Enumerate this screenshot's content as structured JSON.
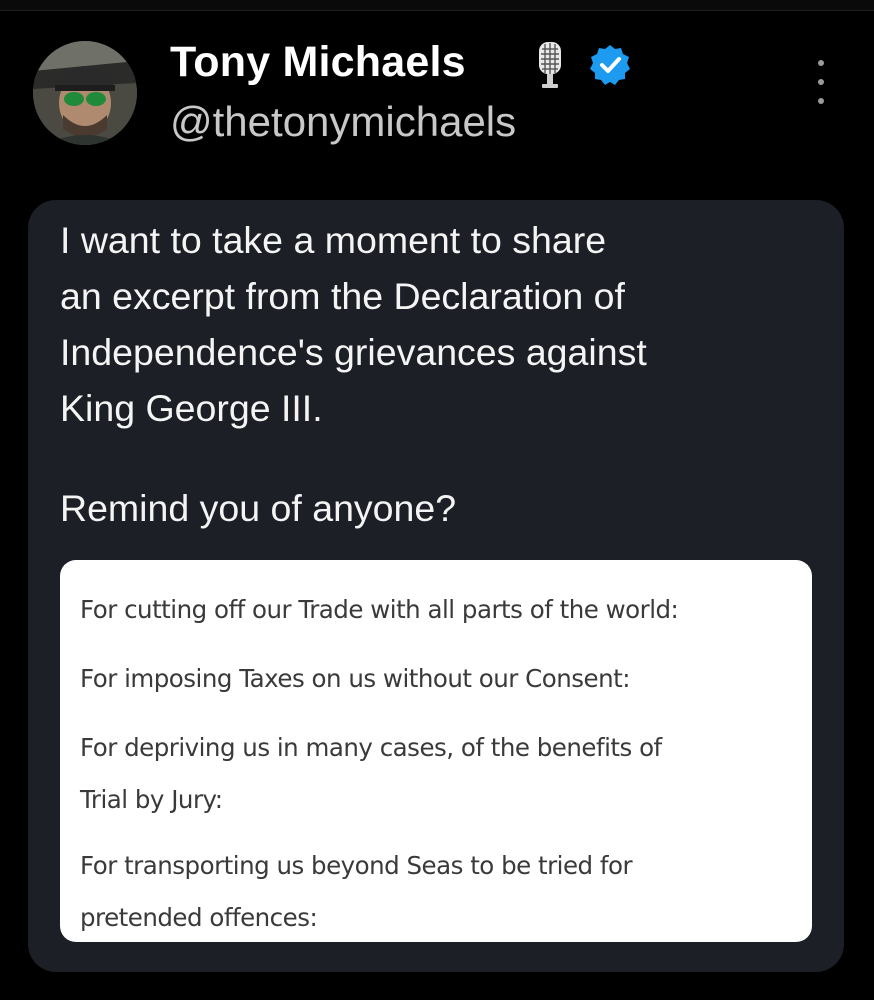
{
  "author": {
    "display_name": "Tony Michaels",
    "handle": "@thetonymichaels",
    "badge_icons": [
      "microphone-icon",
      "verified-badge-icon"
    ],
    "badge_color": "#1d9bf0"
  },
  "post": {
    "text": "I want to take a moment to share\nan excerpt from the Declaration of\nIndependence's grievances against\nKing George III.",
    "followup": "Remind you of anyone?",
    "grievances": [
      "For cutting off our Trade with all parts of the world:",
      "For imposing Taxes on us without our Consent:",
      "For depriving us in many cases, of the benefits of\nTrial by Jury:",
      "For transporting us beyond Seas to be tried for\npretended offences:"
    ]
  },
  "colors": {
    "background": "#000000",
    "card": "#1c1f26",
    "quote_background": "#ffffff",
    "quote_text": "#3a3a3a"
  }
}
